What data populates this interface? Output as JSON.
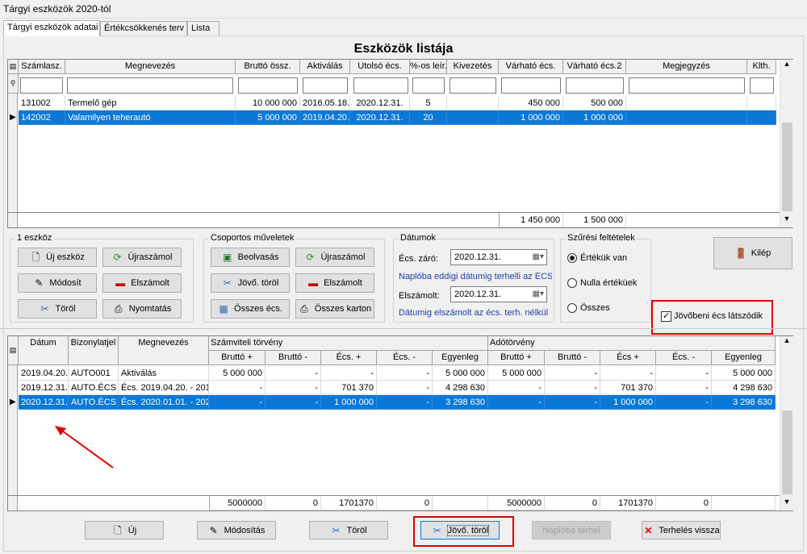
{
  "window": {
    "title": "Tárgyi eszközök 2020-tól"
  },
  "tabs": [
    "Tárgyi eszközök adatai",
    "Értékcsökkenés terv",
    "Lista"
  ],
  "list_title": "Eszközök listája",
  "top_grid": {
    "columns": [
      "Számlasz.",
      "Megnevezés",
      "Bruttó össz.",
      "Aktiválás",
      "Utolsó écs.",
      "%-os leír.",
      "Kivezetés",
      "Várható écs.",
      "Várható écs.2",
      "Megjegyzés",
      "Klth."
    ],
    "rows": [
      [
        "131002",
        "Termelő gép",
        "10 000 000",
        "2016.05.18.",
        "2020.12.31.",
        "5",
        "",
        "450 000",
        "500 000",
        "",
        ""
      ],
      [
        "142002",
        "Valamilyen teherautó",
        "5 000 000",
        "2019.04.20.",
        "2020.12.31.",
        "20",
        "",
        "1 000 000",
        "1 000 000",
        "",
        ""
      ]
    ],
    "totals": {
      "varhato": "1 450 000",
      "varhato2": "1 500 000"
    }
  },
  "group_eszkoz": {
    "label": "1 eszköz",
    "buttons": [
      "Új eszköz",
      "Újraszámol",
      "Módosít",
      "Elszámolt",
      "Töröl",
      "Nyomtatás"
    ]
  },
  "group_csoport": {
    "label": "Csoportos műveletek",
    "buttons": [
      "Beolvasás",
      "Újraszámol",
      "Jövő. töröl",
      "Elszámolt",
      "Összes écs.",
      "Összes karton"
    ]
  },
  "group_datum": {
    "label": "Dátumok",
    "ecs_zaro_label": "Écs. záró:",
    "ecs_zaro": "2020.12.31.",
    "note1": "Naplóba eddigi dátumig terhelli az ÉCS-t",
    "elszamolt_label": "Elszámolt:",
    "elszamolt": "2020.12.31.",
    "note2": "Dátumig elszámolt az écs. terh. nélkül"
  },
  "group_szures": {
    "label": "Szűrési feltételek",
    "options": [
      "Értékük van",
      "Nulla értéküek",
      "Összes"
    ]
  },
  "kilep": "Kilép",
  "checkbox_label": "Jövőbeni écs látszódik",
  "bottom_grid": {
    "columns": [
      "Dátum",
      "Bizonylatjel",
      "Megnevezés"
    ],
    "group1": "Számviteli törvény",
    "group2": "Adótörvény",
    "subcols": [
      "Bruttó +",
      "Bruttó -",
      "Écs. +",
      "Écs. -",
      "Egyenleg",
      "Bruttó +",
      "Bruttó -",
      "Écs +",
      "Écs. -",
      "Egyenleg"
    ],
    "rows": [
      [
        "2019.04.20.",
        "AUTO001",
        "Aktiválás",
        "5 000 000",
        "-",
        "-",
        "-",
        "5 000 000",
        "5 000 000",
        "-",
        "-",
        "-",
        "5 000 000"
      ],
      [
        "2019.12.31.",
        "AUTO.ÉCS",
        "Écs. 2019.04.20. - 201",
        "-",
        "-",
        "701 370",
        "-",
        "4 298 630",
        "-",
        "-",
        "701 370",
        "-",
        "4 298 630"
      ],
      [
        "2020.12.31.",
        "AUTO.ÉCS",
        "Écs. 2020.01.01. - 202",
        "-",
        "-",
        "1 000 000",
        "-",
        "3 298 630",
        "-",
        "-",
        "1 000 000",
        "-",
        "3 298 630"
      ]
    ],
    "totals": [
      "5000000",
      "0",
      "1701370",
      "0",
      "",
      "5000000",
      "0",
      "1701370",
      "0",
      ""
    ]
  },
  "bottom_buttons": [
    "Új",
    "Módosítás",
    "Töröl",
    "Jövő. töröl",
    "Naplóba terhel",
    "Terhelés vissza"
  ]
}
